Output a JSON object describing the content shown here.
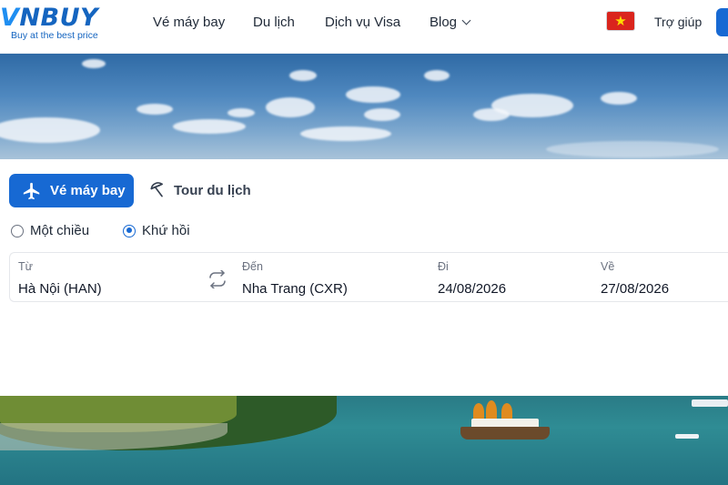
{
  "header": {
    "logo": {
      "word_prefix": "V",
      "word_rest": "NBUY",
      "tagline": "Buy at the best price"
    },
    "nav": [
      {
        "label": "Vé máy bay"
      },
      {
        "label": "Du lịch"
      },
      {
        "label": "Dịch vụ Visa"
      },
      {
        "label": "Blog",
        "icon": "chevron-down-icon"
      }
    ],
    "flag": {
      "icon": "vietnam-flag-icon",
      "star": "★"
    },
    "help_label": "Trợ giúp"
  },
  "search": {
    "tabs": [
      {
        "label": "Vé máy bay",
        "icon": "airplane-icon",
        "active": true
      },
      {
        "label": "Tour du lịch",
        "icon": "beach-umbrella-icon",
        "active": false
      }
    ],
    "trip_types": [
      {
        "label": "Một chiều",
        "selected": false
      },
      {
        "label": "Khứ hồi",
        "selected": true
      }
    ],
    "fields": {
      "from": {
        "label": "Từ",
        "value": "Hà Nội (HAN)"
      },
      "to": {
        "label": "Đến",
        "value": "Nha Trang (CXR)"
      },
      "depart": {
        "label": "Đi",
        "value": "24/08/2026"
      },
      "return": {
        "label": "Về",
        "value": "27/08/2026"
      }
    },
    "swap_icon": "swap-arrows-icon"
  },
  "colors": {
    "primary": "#1769d3",
    "logo_blue": "#1565c0",
    "flag_red": "#da251d",
    "flag_star": "#ffdd00"
  }
}
